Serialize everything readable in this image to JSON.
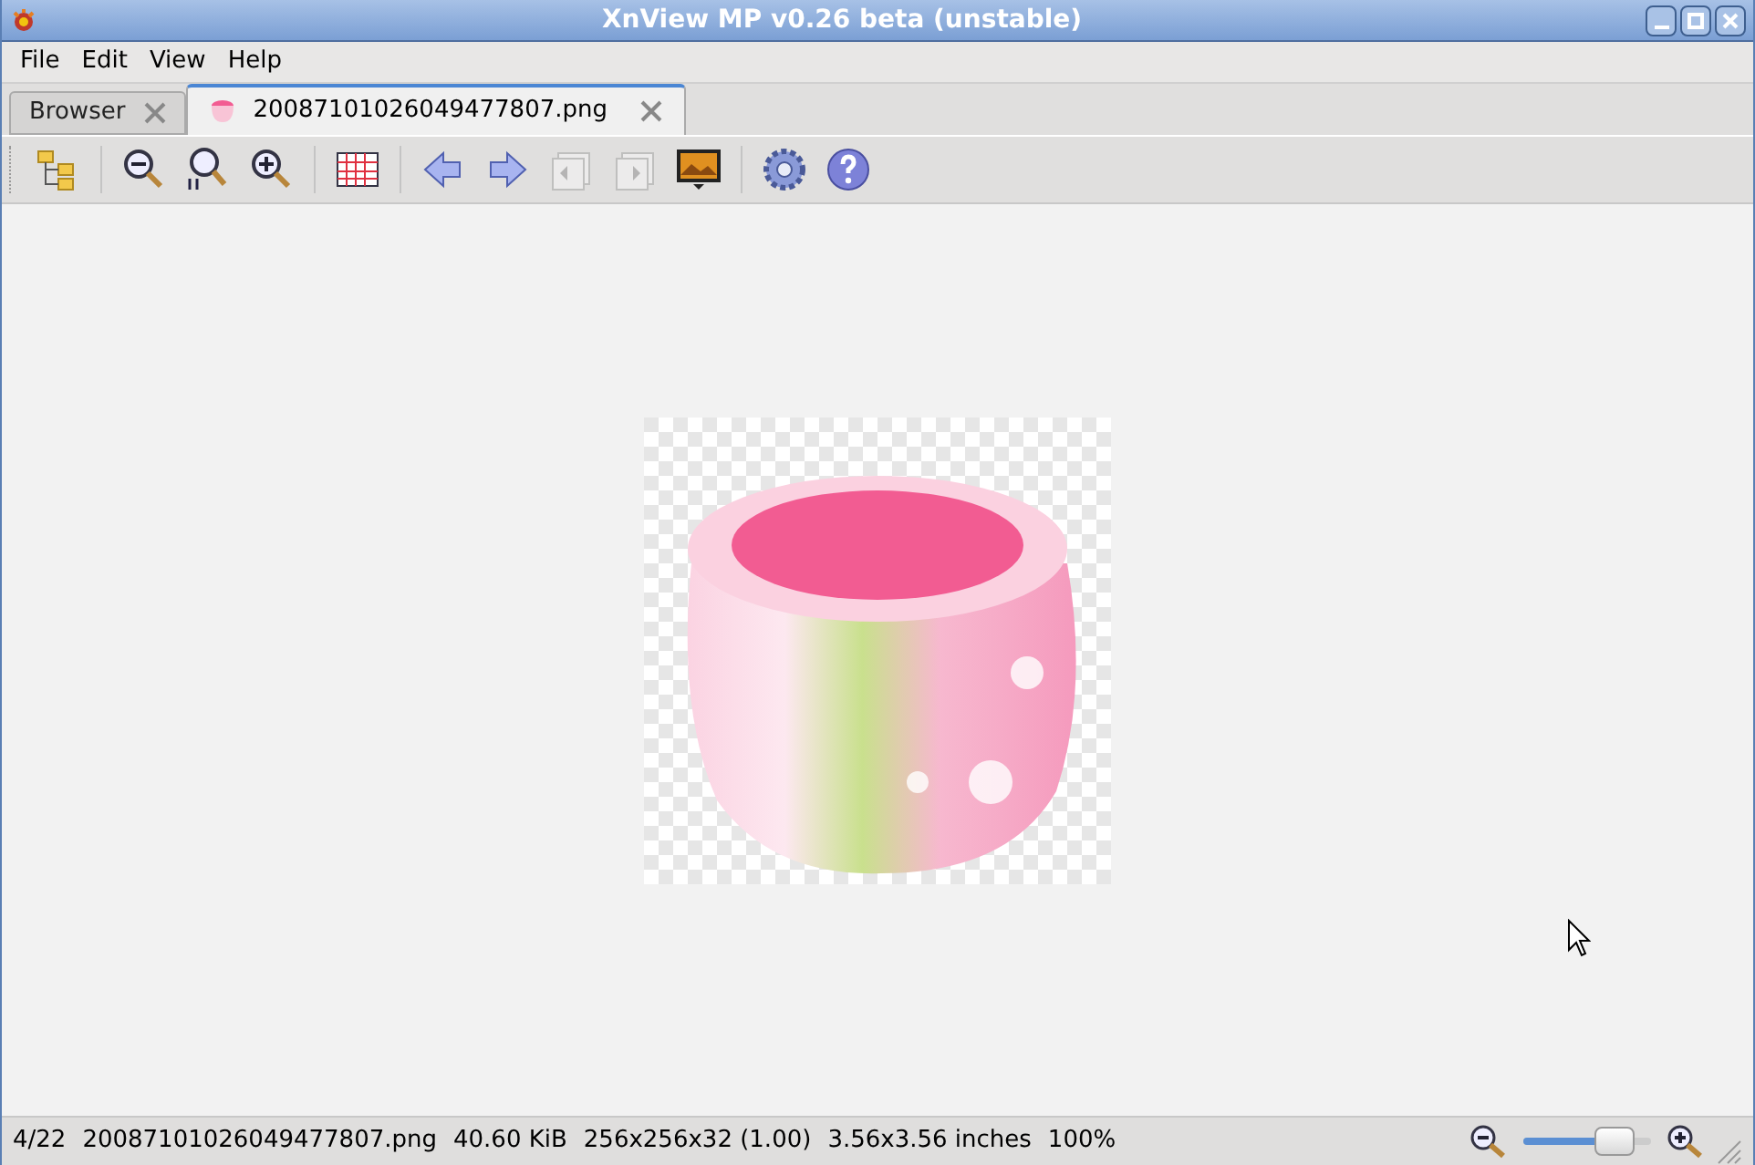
{
  "window": {
    "title": "XnView MP v0.26 beta (unstable)"
  },
  "menu": [
    "File",
    "Edit",
    "View",
    "Help"
  ],
  "tabs": [
    {
      "label": "Browser",
      "selected": false,
      "kind": "browser"
    },
    {
      "label": "20087101026049477807.png",
      "selected": true,
      "kind": "image"
    }
  ],
  "toolbar": [
    {
      "kind": "folders",
      "disabled": false
    },
    {
      "kind": "sep"
    },
    {
      "kind": "zoom-out",
      "disabled": false
    },
    {
      "kind": "zoom-100",
      "disabled": false
    },
    {
      "kind": "zoom-in",
      "disabled": false
    },
    {
      "kind": "sep"
    },
    {
      "kind": "grid",
      "disabled": false
    },
    {
      "kind": "sep"
    },
    {
      "kind": "prev",
      "disabled": false
    },
    {
      "kind": "next",
      "disabled": false
    },
    {
      "kind": "prev-page",
      "disabled": true
    },
    {
      "kind": "next-page",
      "disabled": true
    },
    {
      "kind": "slideshow",
      "disabled": false
    },
    {
      "kind": "sep"
    },
    {
      "kind": "settings",
      "disabled": false
    },
    {
      "kind": "help",
      "disabled": false
    }
  ],
  "status_bar": {
    "items": [
      "4/22",
      "20087101026049477807.png",
      "40.60 KiB",
      "256x256x32 (1.00)",
      "3.56x3.56 inches",
      "100%"
    ],
    "zoom": {
      "level": 0.82
    }
  }
}
